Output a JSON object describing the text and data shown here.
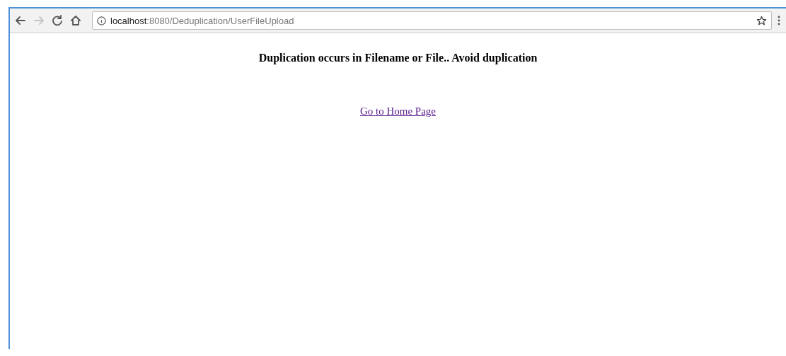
{
  "address_bar": {
    "host": "localhost",
    "path": ":8080/Deduplication/UserFileUpload"
  },
  "page": {
    "heading": "Duplication occurs in Filename or File.. Avoid duplication",
    "link": "Go to Home Page"
  }
}
